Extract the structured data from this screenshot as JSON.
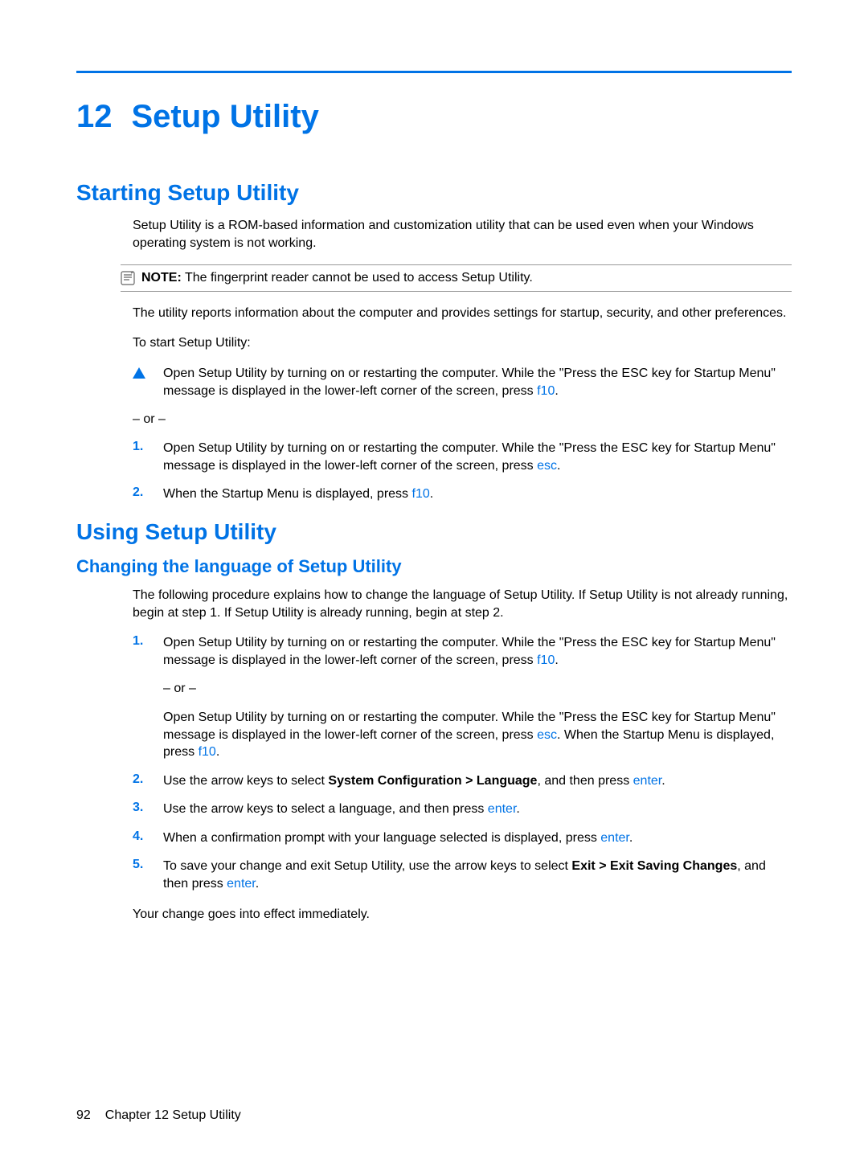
{
  "chapter": {
    "number": "12",
    "title": "Setup Utility"
  },
  "section1": {
    "heading": "Starting Setup Utility",
    "p1": "Setup Utility is a ROM-based information and customization utility that can be used even when your Windows operating system is not working.",
    "note_label": "NOTE:",
    "note_text": "The fingerprint reader cannot be used to access Setup Utility.",
    "p2": "The utility reports information about the computer and provides settings for startup, security, and other preferences.",
    "p3": "To start Setup Utility:",
    "bullet1_a": "Open Setup Utility by turning on or restarting the computer. While the \"Press the ESC key for Startup Menu\" message is displayed in the lower-left corner of the screen, press ",
    "bullet1_key": "f10",
    "or": "– or –",
    "step1_num": "1.",
    "step1_a": "Open Setup Utility by turning on or restarting the computer. While the \"Press the ESC key for Startup Menu\" message is displayed in the lower-left corner of the screen, press ",
    "step1_key": "esc",
    "step2_num": "2.",
    "step2_a": "When the Startup Menu is displayed, press ",
    "step2_key": "f10"
  },
  "section2": {
    "heading": "Using Setup Utility",
    "sub1": {
      "heading": "Changing the language of Setup Utility",
      "p1": "The following procedure explains how to change the language of Setup Utility. If Setup Utility is not already running, begin at step 1. If Setup Utility is already running, begin at step 2.",
      "step1_num": "1.",
      "step1_a": "Open Setup Utility by turning on or restarting the computer. While the \"Press the ESC key for Startup Menu\" message is displayed in the lower-left corner of the screen, press ",
      "step1_key": "f10",
      "step1_or": "– or –",
      "step1_b": "Open Setup Utility by turning on or restarting the computer. While the \"Press the ESC key for Startup Menu\" message is displayed in the lower-left corner of the screen, press ",
      "step1_b_key": "esc",
      "step1_b2": ". When the Startup Menu is displayed, press ",
      "step1_b2_key": "f10",
      "step2_num": "2.",
      "step2_a": "Use the arrow keys to select ",
      "step2_bold": "System Configuration > Language",
      "step2_b": ", and then press ",
      "step2_key": "enter",
      "step3_num": "3.",
      "step3_a": "Use the arrow keys to select a language, and then press ",
      "step3_key": "enter",
      "step4_num": "4.",
      "step4_a": "When a confirmation prompt with your language selected is displayed, press ",
      "step4_key": "enter",
      "step5_num": "5.",
      "step5_a": "To save your change and exit Setup Utility, use the arrow keys to select ",
      "step5_bold": "Exit > Exit Saving Changes",
      "step5_b": ", and then press ",
      "step5_key": "enter",
      "p_end": "Your change goes into effect immediately."
    }
  },
  "footer": {
    "page": "92",
    "text": "Chapter 12   Setup Utility"
  }
}
